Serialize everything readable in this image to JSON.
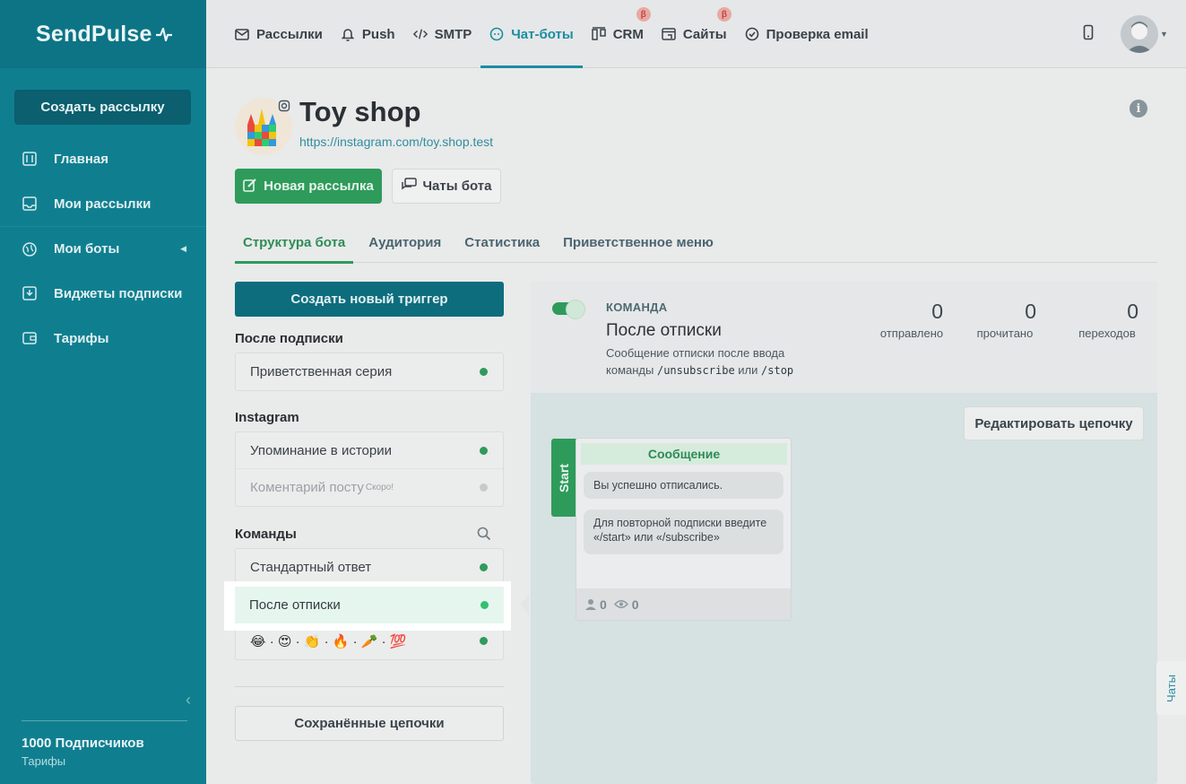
{
  "brand": {
    "name": "SendPulse"
  },
  "sidebar": {
    "create_label": "Создать рассылку",
    "items": [
      {
        "label": "Главная",
        "icon": "sliders-icon"
      },
      {
        "label": "Мои рассылки",
        "icon": "inbox-icon"
      },
      {
        "label": "Мои боты",
        "icon": "globe-icon"
      },
      {
        "label": "Виджеты подписки",
        "icon": "widget-icon"
      },
      {
        "label": "Тарифы",
        "icon": "wallet-icon"
      }
    ],
    "subscribers": "1000 Подписчиков",
    "tariffs_link": "Тарифы"
  },
  "topnav": {
    "tabs": [
      {
        "label": "Рассылки",
        "icon": "mail-icon"
      },
      {
        "label": "Push",
        "icon": "bell-icon"
      },
      {
        "label": "SMTP",
        "icon": "code-icon"
      },
      {
        "label": "Чат-боты",
        "icon": "chatbot-icon"
      },
      {
        "label": "CRM",
        "icon": "crm-icon",
        "badge": "β"
      },
      {
        "label": "Сайты",
        "icon": "site-icon",
        "badge": "β"
      },
      {
        "label": "Проверка email",
        "icon": "check-icon"
      }
    ]
  },
  "bot": {
    "title": "Toy shop",
    "link": "https://instagram.com/toy.shop.test",
    "new_mailing_label": "Новая рассылка",
    "bot_chats_label": "Чаты бота"
  },
  "subtabs": [
    "Структура бота",
    "Аудитория",
    "Статистика",
    "Приветственное меню"
  ],
  "triggers": {
    "create_label": "Создать новый триггер",
    "after_subscribe": {
      "title": "После подписки",
      "items": [
        {
          "label": "Приветственная серия"
        }
      ]
    },
    "instagram": {
      "title": "Instagram",
      "items": [
        {
          "label": "Упоминание в истории"
        },
        {
          "label": "Коментарий посту",
          "sup": "Скоро!"
        }
      ]
    },
    "commands": {
      "title": "Команды",
      "items": [
        {
          "label": "Стандартный ответ"
        },
        {
          "label": "После отписки"
        },
        {
          "label": "😂 · 😍 · 👏 · 🔥 · 🥕 · 💯"
        }
      ]
    },
    "saved_label": "Сохранённые цепочки"
  },
  "command_panel": {
    "type_label": "КОМАНДА",
    "name": "После отписки",
    "desc_text": "Сообщение отписки после ввода команды",
    "desc_cmd1": "/unsubscribe",
    "desc_or": "или",
    "desc_cmd2": "/stop",
    "stats": [
      {
        "num": "0",
        "label": "отправлено"
      },
      {
        "num": "0",
        "label": "прочитано"
      },
      {
        "num": "0",
        "label": "переходов"
      }
    ],
    "edit_label": "Редактировать цепочку",
    "start_label": "Start",
    "message": {
      "title": "Сообщение",
      "bubble1": "Вы успешно отписались.",
      "bubble2": "Для повторной подписки введите «/start» или «/subscribe»",
      "users": "0",
      "views": "0"
    }
  },
  "chats_side_label": "Чаты",
  "colors": {
    "sidebar": "#0f7f90",
    "accent": "#1a8ea1",
    "green": "#2e9b5b"
  }
}
